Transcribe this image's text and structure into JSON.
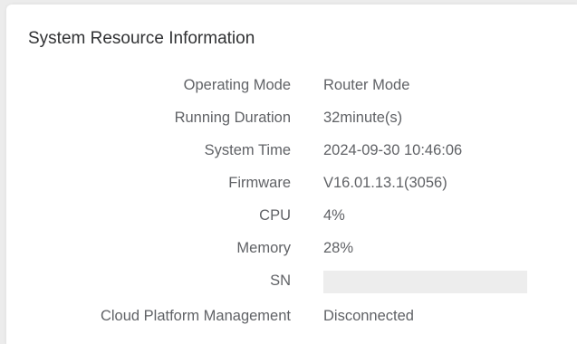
{
  "panel": {
    "title": "System Resource Information",
    "rows": [
      {
        "label": "Operating Mode",
        "value": "Router Mode"
      },
      {
        "label": "Running Duration",
        "value": "32minute(s)"
      },
      {
        "label": "System Time",
        "value": "2024-09-30 10:46:06"
      },
      {
        "label": "Firmware",
        "value": "V16.01.13.1(3056)"
      },
      {
        "label": "CPU",
        "value": "4%"
      },
      {
        "label": "Memory",
        "value": "28%"
      },
      {
        "label": "SN",
        "value": ""
      },
      {
        "label": "Cloud Platform Management",
        "value": "Disconnected"
      }
    ]
  }
}
